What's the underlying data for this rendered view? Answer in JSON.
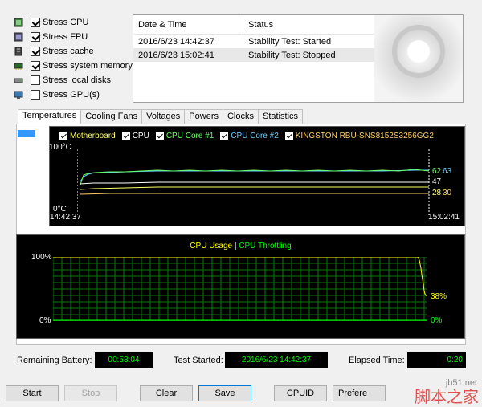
{
  "stress": {
    "items": [
      {
        "label": "Stress CPU",
        "checked": true,
        "icon": "cpu-icon"
      },
      {
        "label": "Stress FPU",
        "checked": true,
        "icon": "fpu-icon"
      },
      {
        "label": "Stress cache",
        "checked": true,
        "icon": "cache-icon"
      },
      {
        "label": "Stress system memory",
        "checked": true,
        "icon": "memory-icon"
      },
      {
        "label": "Stress local disks",
        "checked": false,
        "icon": "disk-icon"
      },
      {
        "label": "Stress GPU(s)",
        "checked": false,
        "icon": "gpu-icon"
      }
    ]
  },
  "log": {
    "col_datetime": "Date & Time",
    "col_status": "Status",
    "rows": [
      {
        "datetime": "2016/6/23 14:42:37",
        "status": "Stability Test: Started"
      },
      {
        "datetime": "2016/6/23 15:02:41",
        "status": "Stability Test: Stopped"
      }
    ]
  },
  "tabs": [
    "Temperatures",
    "Cooling Fans",
    "Voltages",
    "Powers",
    "Clocks",
    "Statistics"
  ],
  "temp_graph": {
    "legend": [
      {
        "label": "Motherboard",
        "color": "#ffff66"
      },
      {
        "label": "CPU",
        "color": "#ffffff"
      },
      {
        "label": "CPU Core #1",
        "color": "#66ff66"
      },
      {
        "label": "CPU Core #2",
        "color": "#66ccff"
      },
      {
        "label": "KINGSTON RBU-SNS8152S3256GG2",
        "color": "#ffcc66"
      }
    ],
    "y_top": "100°C",
    "y_bottom": "0°C",
    "x_start": "14:42:37",
    "x_end": "15:02:41",
    "val_62": "62",
    "val_63": "63",
    "val_47": "47",
    "val_28": "28",
    "val_30": "30"
  },
  "cpu_graph": {
    "title_usage": "CPU Usage",
    "separator": "|",
    "title_throttle": "CPU Throttling",
    "y_top": "100%",
    "y_bottom": "0%",
    "right_38": "38%",
    "right_0": "0%",
    "usage_color": "#ffff00",
    "throttle_color": "#00ff00"
  },
  "status": {
    "battery_label": "Remaining Battery:",
    "battery_value": "00:53:04",
    "started_label": "Test Started:",
    "started_value": "2016/6/23 14:42:37",
    "elapsed_label": "Elapsed Time:",
    "elapsed_value": "0:20"
  },
  "buttons": {
    "start": "Start",
    "stop": "Stop",
    "clear": "Clear",
    "save": "Save",
    "cpuid": "CPUID",
    "preferences": "Prefere"
  },
  "watermark": {
    "site": "jb51.net",
    "brand": "脚本之家"
  }
}
